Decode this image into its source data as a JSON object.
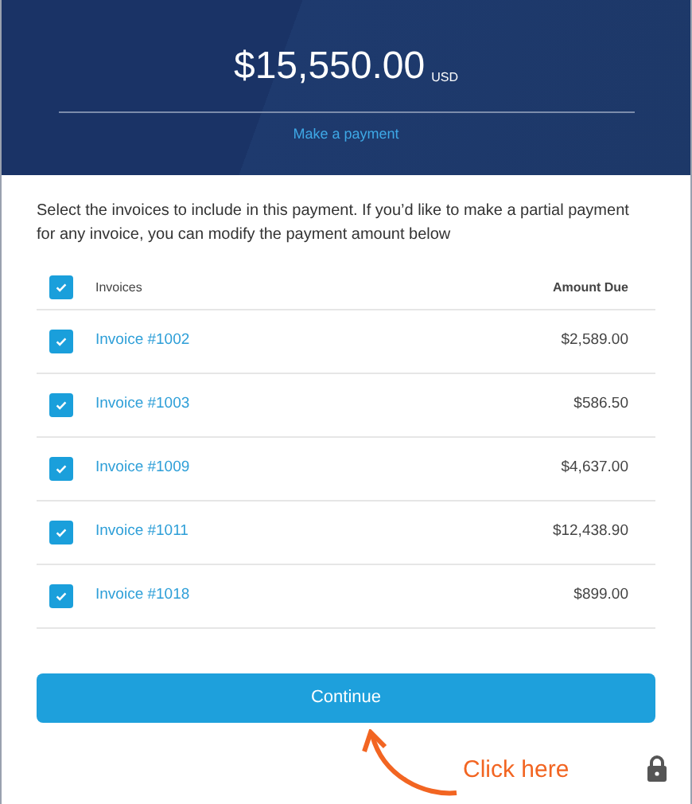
{
  "header": {
    "amount": "$15,550.00",
    "currency": "USD",
    "link": "Make a payment"
  },
  "instructions": "Select the invoices to include in this payment. If you’d like to make a partial payment for any invoice, you can modify the payment amount below",
  "table": {
    "select_all": {
      "checked": true
    },
    "columns": [
      "Invoices",
      "Amount Due"
    ],
    "rows": [
      {
        "invoice": "Invoice #1002",
        "amount": "$2,589.00",
        "checked": true
      },
      {
        "invoice": "Invoice #1003",
        "amount": "$586.50",
        "checked": true
      },
      {
        "invoice": "Invoice #1009",
        "amount": "$4,637.00",
        "checked": true
      },
      {
        "invoice": "Invoice #1011",
        "amount": "$12,438.90",
        "checked": true
      },
      {
        "invoice": "Invoice #1018",
        "amount": "$899.00",
        "checked": true
      }
    ]
  },
  "continue_button": "Continue",
  "annotation": "Click here"
}
